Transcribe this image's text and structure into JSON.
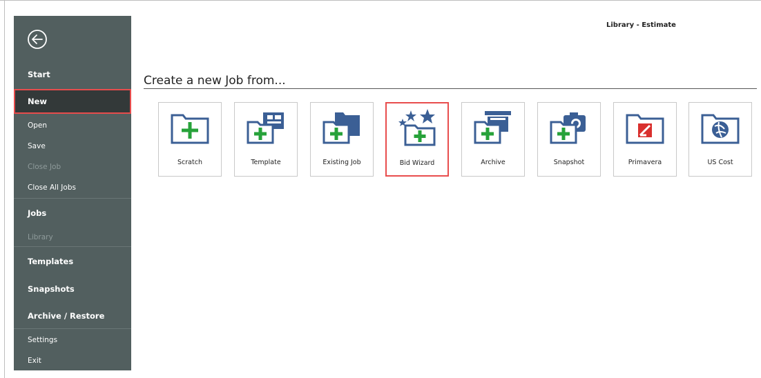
{
  "header": {
    "title": "Library - Estimate"
  },
  "sidebar": {
    "items": [
      {
        "label": "Start"
      },
      {
        "label": "New"
      },
      {
        "label": "Open"
      },
      {
        "label": "Save"
      },
      {
        "label": "Close Job"
      },
      {
        "label": "Close All Jobs"
      },
      {
        "label": "Jobs"
      },
      {
        "label": "Library"
      },
      {
        "label": "Templates"
      },
      {
        "label": "Snapshots"
      },
      {
        "label": "Archive / Restore"
      },
      {
        "label": "Settings"
      },
      {
        "label": "Exit"
      }
    ]
  },
  "main": {
    "heading": "Create a new Job from...",
    "tiles": [
      {
        "label": "Scratch",
        "icon": "folder-plus-icon"
      },
      {
        "label": "Template",
        "icon": "template-folder-icon"
      },
      {
        "label": "Existing Job",
        "icon": "existing-job-folder-icon"
      },
      {
        "label": "Bid Wizard",
        "icon": "bid-wizard-stars-icon",
        "highlighted": true
      },
      {
        "label": "Archive",
        "icon": "archive-folder-icon"
      },
      {
        "label": "Snapshot",
        "icon": "camera-folder-icon"
      },
      {
        "label": "Primavera",
        "icon": "primavera-icon"
      },
      {
        "label": "US Cost",
        "icon": "us-cost-icon"
      }
    ]
  },
  "colors": {
    "sidebar_bg": "#525f5f",
    "selected_bg": "#333939",
    "highlight": "#e84c4c",
    "icon_blue": "#3b5f95",
    "icon_green": "#27a23a"
  }
}
